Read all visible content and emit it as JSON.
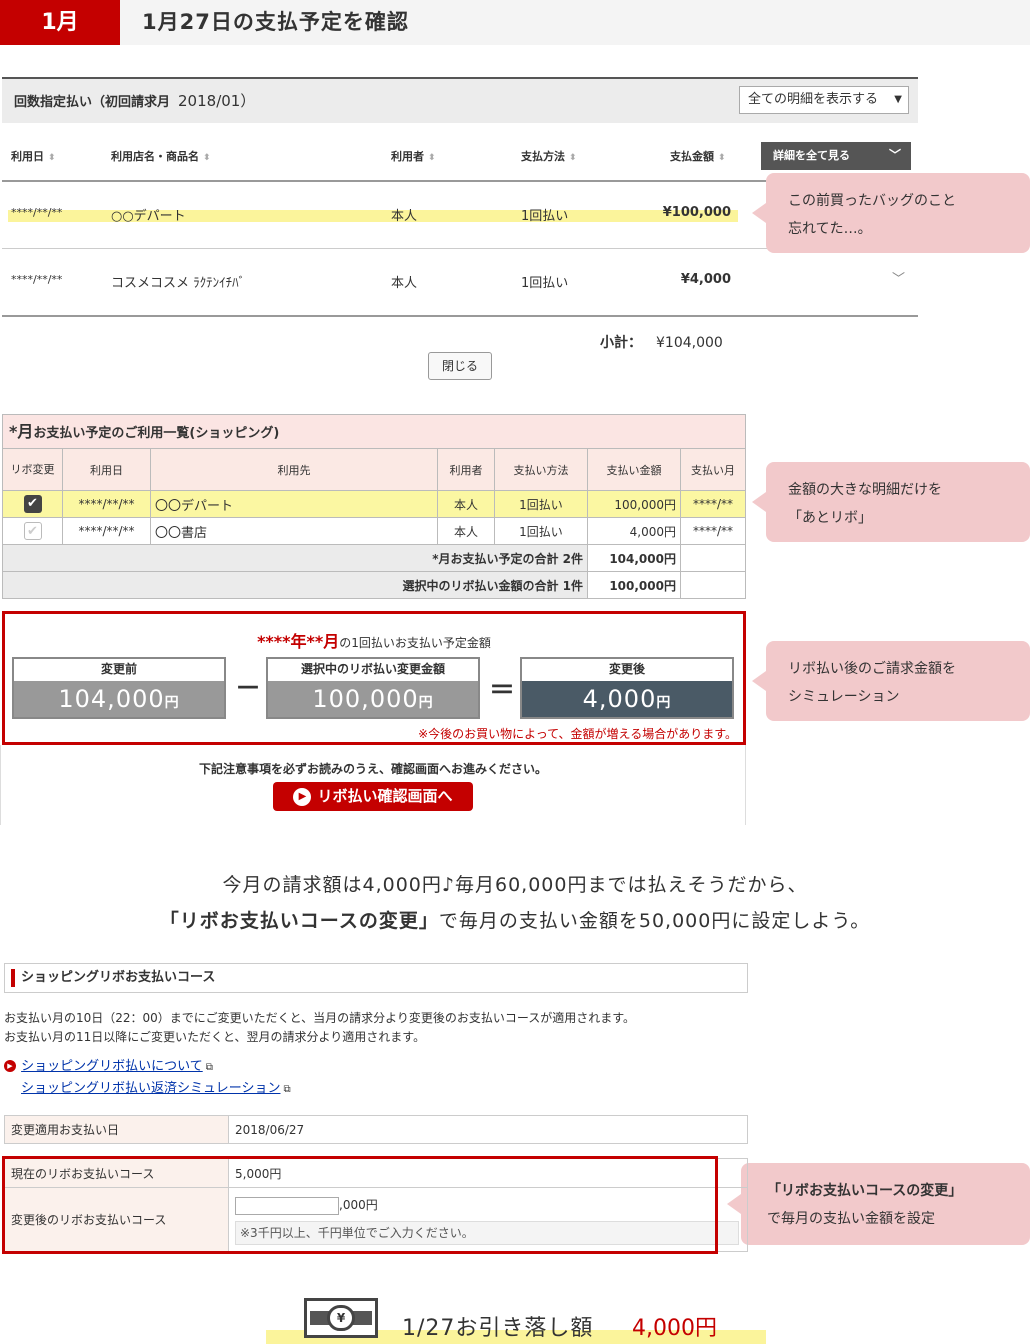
{
  "header": {
    "month": "1月",
    "title": "1月27日の支払予定を確認"
  },
  "sec1": {
    "bar_label": "回数指定払い（初回請求月",
    "bar_month": "2018/01）",
    "select_value": "全ての明細を表示する",
    "columns": [
      "利用日",
      "利用店名・商品名",
      "利用者",
      "支払方法",
      "支払金額"
    ],
    "detail_button": "詳細を全て見る",
    "rows": [
      {
        "date": "****/**/**",
        "store": "○○デパート",
        "user": "本人",
        "method": "1回払い",
        "amount": "¥100,000"
      },
      {
        "date": "****/**/**",
        "store": "コスメコスメ ﾗｸﾃﾝｲﾁﾊﾞ",
        "user": "本人",
        "method": "1回払い",
        "amount": "¥4,000"
      }
    ],
    "subtotal_label": "小計：",
    "subtotal_value": "¥104,000",
    "close_button": "閉じる"
  },
  "bubbles": {
    "b1": [
      "この前買ったバッグのこと",
      "忘れてた…。"
    ],
    "b2": [
      "金額の大きな明細だけを",
      "「あとリボ」"
    ],
    "b3": [
      "リボ払い後のご請求金額を",
      "シミュレーション"
    ],
    "b4": [
      "「リボお支払いコースの変更」",
      "で毎月の支払い金額を設定"
    ]
  },
  "sec2": {
    "caption_big": "*月",
    "caption": "お支払い予定のご利用一覧(ショッピング)",
    "columns": [
      "リボ変更",
      "利用日",
      "利用先",
      "利用者",
      "支払い方法",
      "支払い金額",
      "支払い月"
    ],
    "rows": [
      {
        "date": "****/**/**",
        "store": "〇〇デパート",
        "user": "本人",
        "method": "1回払い",
        "amount": "100,000円",
        "month": "****/**",
        "checked": true
      },
      {
        "date": "****/**/**",
        "store": "〇〇書店",
        "user": "本人",
        "method": "1回払い",
        "amount": "4,000円",
        "month": "****/**",
        "checked": false
      }
    ],
    "total_label": "*月お支払い予定の合計 2件",
    "total_value": "104,000円",
    "selected_label": "選択中のリボ払い金額の合計 1件",
    "selected_value": "100,000円"
  },
  "sim": {
    "head_red": "****年**月",
    "head": "の1回払いお支払い予定金額",
    "before_label": "変更前",
    "before_value": "104,000",
    "minus": "－",
    "mid_label": "選択中のリボ払い変更金額",
    "mid_value": "100,000",
    "equals": "＝",
    "after_label": "変更後",
    "after_value": "4,000",
    "yen": "円",
    "note": "※今後のお買い物によって、金額が増える場合があります。"
  },
  "confirm": {
    "text": "下記注意事項を必ずお読みのうえ、確認画面へお進みください。",
    "button": "リボ払い確認画面へ"
  },
  "message": {
    "line1": "今月の請求額は4,000円♪毎月60,000円までは払えそうだから、",
    "line2_bold": "「リボお支払いコースの変更」",
    "line2": "で毎月の支払い金額を50,000円に設定しよう。"
  },
  "sec3": {
    "bar": "ショッピングリボお支払いコース",
    "desc1": "お支払い月の10日（22：00）までにご変更いただくと、当月の請求分より変更後のお支払いコースが適用されます。",
    "desc2": "お支払い月の11日以降にご変更いただくと、翌月の請求分より適用されます。",
    "link1": "ショッピングリボ払いについて",
    "link2": "ショッピングリボ払い返済シミュレーション",
    "apply_label": "変更適用お支払い日",
    "apply_value": "2018/06/27",
    "current_label": "現在のリボお支払いコース",
    "current_value": "5,000円",
    "new_label": "変更後のリボお支払いコース",
    "new_suffix": ",000円",
    "new_note": "※3千円以上、千円単位でご入力ください。"
  },
  "footer": {
    "text": "1/27お引き落し額",
    "amount": "4,000円"
  }
}
